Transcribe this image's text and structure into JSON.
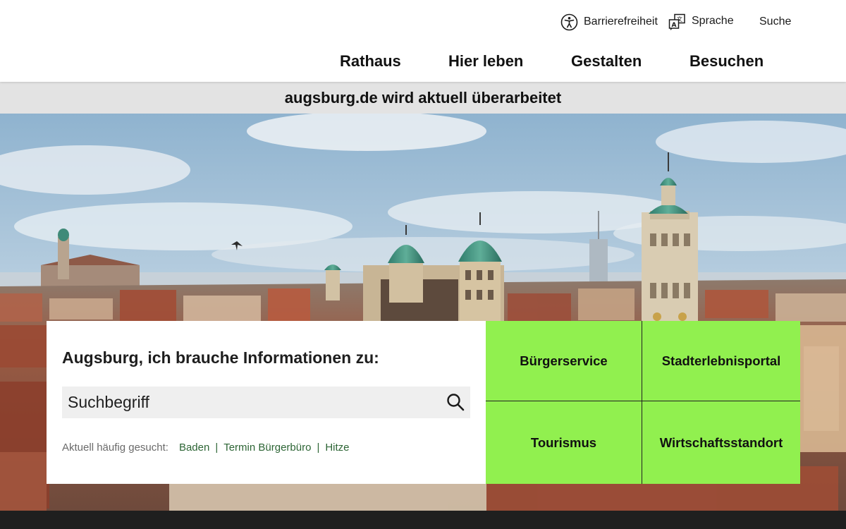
{
  "header": {
    "utility": {
      "accessibility_label": "Barrierefreiheit",
      "language_label": "Sprache",
      "search_label": "Suche"
    },
    "nav": [
      {
        "label": "Rathaus"
      },
      {
        "label": "Hier leben"
      },
      {
        "label": "Gestalten"
      },
      {
        "label": "Besuchen"
      }
    ]
  },
  "notice": {
    "text": "augsburg.de wird aktuell überarbeitet"
  },
  "search_panel": {
    "title": "Augsburg, ich brauche Informationen zu:",
    "input_placeholder": "Suchbegriff",
    "input_value": "",
    "popular_label": "Aktuell häufig gesucht:",
    "popular_links": [
      {
        "label": "Baden"
      },
      {
        "label": "Termin Bürgerbüro"
      },
      {
        "label": "Hitze"
      }
    ]
  },
  "tiles": [
    {
      "label": "Bürgerservice"
    },
    {
      "label": "Stadterlebnisportal"
    },
    {
      "label": "Tourismus"
    },
    {
      "label": "Wirtschaftsstandort"
    }
  ],
  "icons": {
    "accessibility": "accessibility-person-icon",
    "language": "language-translate-icon",
    "search": "magnifier-icon"
  },
  "colors": {
    "tile_background": "#91f04f",
    "notice_background": "#e3e3e3",
    "link_green": "#2d6535",
    "footer_dark": "#1f1f1f",
    "search_field": "#efefef"
  }
}
